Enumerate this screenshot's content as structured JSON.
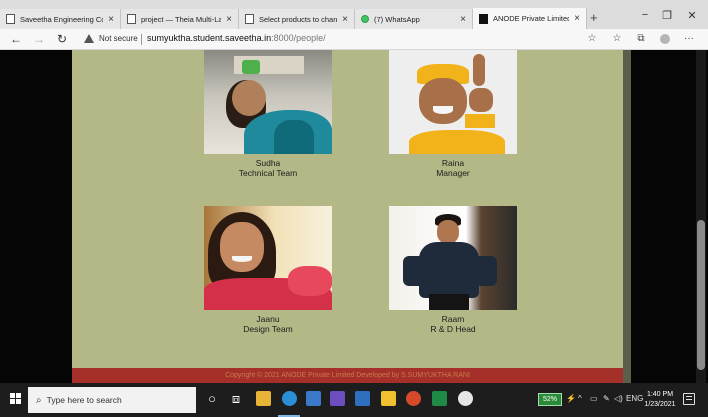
{
  "browser": {
    "tabs": [
      {
        "label": "Saveetha Engineering College",
        "icon": "page-icon",
        "close": "×",
        "active": false
      },
      {
        "label": "project — Theia Multi-Langua",
        "icon": "page-icon",
        "close": "×",
        "active": false
      },
      {
        "label": "Select products to change | Dj",
        "icon": "page-icon",
        "close": "×",
        "active": false
      },
      {
        "label": "(7) WhatsApp",
        "icon": "whatsapp-icon",
        "close": "×",
        "active": false
      },
      {
        "label": "ANODE Private Limited",
        "icon": "site-icon",
        "close": "×",
        "active": true
      }
    ],
    "new_tab": "+",
    "window_controls": {
      "minimize": "−",
      "restore": "❐",
      "close": "✕"
    },
    "nav": {
      "back": "←",
      "forward": "→",
      "refresh": "↻"
    },
    "address": {
      "security": "Not secure",
      "url_host": "sumyuktha.student.saveetha.in",
      "url_path": ":8000/people/"
    },
    "toolbar_icons": {
      "favorite": "☆",
      "favorites_bar": "☆",
      "collections": "⧉",
      "menu": "···"
    }
  },
  "people": [
    {
      "name": "Sudha",
      "role": "Technical Team"
    },
    {
      "name": "Raina",
      "role": "Manager"
    },
    {
      "name": "Jaanu",
      "role": "Design Team"
    },
    {
      "name": "Raam",
      "role": "R & D Head"
    }
  ],
  "footer": {
    "text": "Copyright © 2021 ANODE Private Limited Developed by S.SUMYUKTHA RANI"
  },
  "colors": {
    "page_bg": "#b4b887",
    "footer_bg": "#a5302a",
    "outer_bg": "#050505"
  },
  "taskbar": {
    "search_placeholder": "Type here to search",
    "battery": "52%",
    "language": "ENG",
    "time": "1:40 PM",
    "date": "1/23/2021"
  }
}
